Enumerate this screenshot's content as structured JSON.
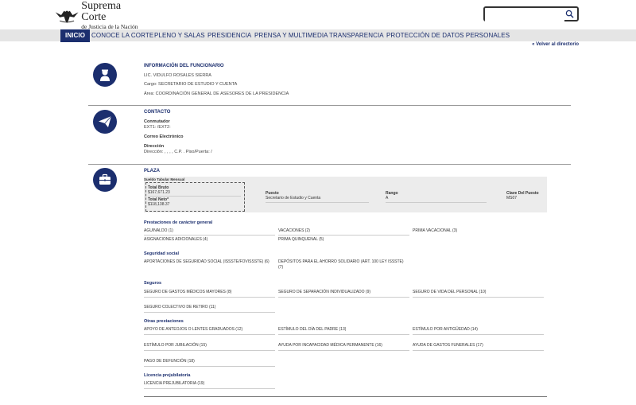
{
  "header": {
    "logo_title": "Suprema Corte",
    "logo_subtitle": "de Justicia de la Nación",
    "search_placeholder": ""
  },
  "nav": {
    "items": [
      "INICIO",
      "CONOCE LA CORTE",
      "PLENO Y SALAS",
      "PRESIDENCIA",
      "PRENSA Y MULTIMEDIA",
      "TRANSPARENCIA",
      "PROTECCIÓN DE DATOS PERSONALES"
    ]
  },
  "back_link": "« Volver al directorio",
  "funcionario": {
    "title": "INFORMACIÓN DEL FUNCIONARIO",
    "name": "LIC. VIDULFO ROSALES SIERRA",
    "cargo": "Cargo: SECRETARIO DE ESTUDIO Y CUENTA",
    "area": "Área: COORDINACIÓN GENERAL DE ASESORES DE LA PRESIDENCIA"
  },
  "contacto": {
    "title": "CONTACTO",
    "conmutador_label": "Conmutador",
    "conmutador_value": "EXT1:  /EXT2:",
    "correo_label": "Correo Electrónico",
    "direccion_label": "Dirección",
    "direccion_value": "Dirección: , , , , C.P. . Piso/Puerta: /"
  },
  "plaza": {
    "title": "PLAZA",
    "sueldo_label": "Sueldo Tabular Mensual",
    "total_bruto_label": "Total Bruto",
    "total_bruto_value": "$167,671.23",
    "total_neto_label": "Total Neto*",
    "total_neto_value": "$118,138.37",
    "puesto_label": "Puesto",
    "puesto_value": "Secretario de Estudio y Cuenta",
    "rango_label": "Rango",
    "rango_value": "A",
    "clave_label": "Clave Del Puesto",
    "clave_value": "MS07"
  },
  "prestaciones_generales": {
    "title": "Prestaciones de carácter general",
    "items": [
      "AGUINALDO (1)",
      "VACACIONES (2)",
      "PRIMA VACACIONAL (3)",
      "ASIGNACIONES ADICIONALES (4)",
      "PRIMA QUINQUENAL (5)"
    ]
  },
  "seguridad_social": {
    "title": "Seguridad social",
    "items": [
      "APORTACIONES DE SEGURIDAD SOCIAL (ISSSTE/FOVISSSTE) (6)",
      "DEPÓSITOS PARA EL AHORRO SOLIDARIO (ART. 100 LEY ISSSTE) (7)"
    ]
  },
  "seguros": {
    "title": "Seguros",
    "items": [
      "SEGURO DE GASTOS MÉDICOS MAYORES (8)",
      "SEGURO DE SEPARACIÓN INDIVIDUALIZADO (9)",
      "SEGURO DE VIDA DEL PERSONAL (10)",
      "SEGURO COLECTIVO DE RETIRO (11)"
    ]
  },
  "otras": {
    "title": "Otras prestaciones",
    "items": [
      "APOYO DE ANTEOJOS O LENTES GRADUADOS (12)",
      "ESTÍMULO DEL DÍA DEL PADRE (13)",
      "ESTÍMULO POR ANTIGÜEDAD (14)",
      "ESTÍMULO POR JUBILACIÓN (15)",
      "AYUDA POR INCAPACIDAD MÉDICA PERMANENTE (16)",
      "AYUDA DE GASTOS FUNERALES (17)",
      "PAGO DE DEFUNCIÓN (18)"
    ]
  },
  "licencia": {
    "title": "Licencia prejubilatoria",
    "items": [
      "LICENCIA PREJUBILATORIA (19)"
    ]
  },
  "colors": {
    "primary": "#1b2e6e",
    "nav_bg": "#e5e5e5",
    "box_bg": "#ececec"
  }
}
